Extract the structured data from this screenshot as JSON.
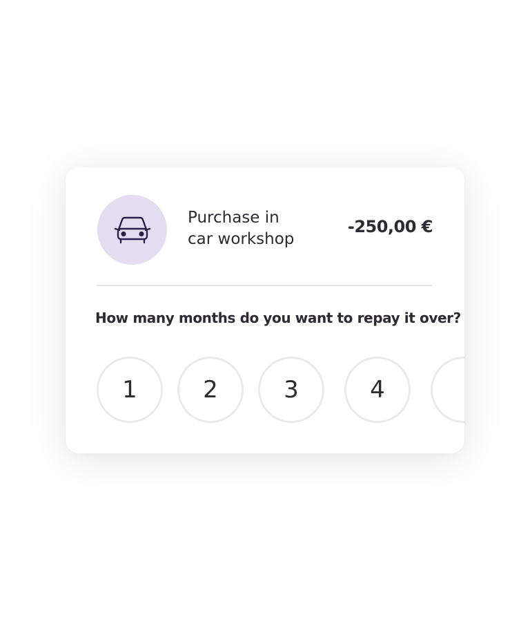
{
  "transaction": {
    "icon": "car-icon",
    "title": "Purchase in\ncar workshop",
    "amount": "-250,00 €"
  },
  "question": "How many months do you want to repay it over?",
  "month_options": [
    "1",
    "2",
    "3",
    "4",
    ""
  ],
  "colors": {
    "icon_bg": "#e4ddf1",
    "icon_stroke": "#2c1f4a",
    "text": "#2d2a31",
    "divider": "#e3e3e6",
    "option_border": "#eaeaea"
  }
}
